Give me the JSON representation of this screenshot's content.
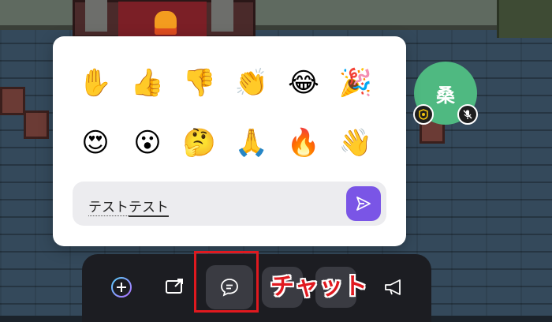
{
  "reactions": {
    "emojis": [
      {
        "glyph": "✋",
        "icon": "raised-hand-icon"
      },
      {
        "glyph": "👍",
        "icon": "thumbs-up-icon"
      },
      {
        "glyph": "👎",
        "icon": "thumbs-down-icon"
      },
      {
        "glyph": "👏",
        "icon": "clapping-hands-icon"
      },
      {
        "glyph": "😂",
        "icon": "tears-of-joy-icon"
      },
      {
        "glyph": "🎉",
        "icon": "party-popper-icon"
      },
      {
        "glyph": "😍",
        "icon": "heart-eyes-icon"
      },
      {
        "glyph": "😮",
        "icon": "surprised-face-icon"
      },
      {
        "glyph": "🤔",
        "icon": "thinking-face-icon"
      },
      {
        "glyph": "🙏",
        "icon": "folded-hands-icon"
      },
      {
        "glyph": "🔥",
        "icon": "fire-icon"
      },
      {
        "glyph": "👋",
        "icon": "waving-hand-icon"
      }
    ]
  },
  "chat": {
    "text_part1": "テスト",
    "text_part2": "テスト",
    "send_icon": "send-icon"
  },
  "user": {
    "avatar_initial": "桑",
    "avatar_color": "#4fb981",
    "role_icon": "badge-icon",
    "mic_icon": "mic-muted-icon"
  },
  "toolbar": {
    "items": [
      "add-icon",
      "screen-share-icon",
      "chat-icon",
      "reaction-icon",
      "reaction-icon",
      "megaphone-icon"
    ]
  },
  "annotation": {
    "label": "チャット",
    "color": "#e0191f"
  },
  "colors": {
    "send_button": "#7a55e6",
    "toolbar_bg": "#1c1d22"
  }
}
